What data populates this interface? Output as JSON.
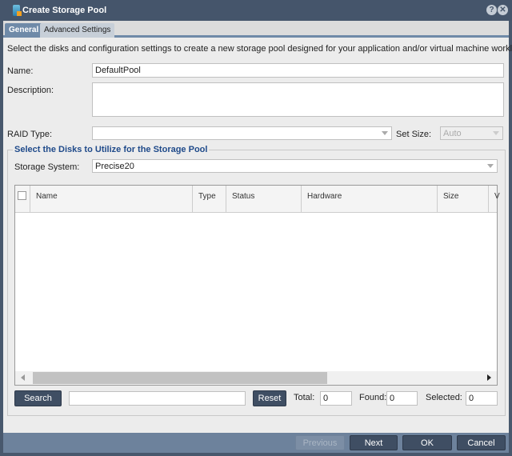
{
  "window": {
    "title": "Create Storage Pool",
    "icons": [
      "help-icon",
      "close-icon"
    ]
  },
  "tabs": [
    {
      "label": "General",
      "active": true
    },
    {
      "label": "Advanced Settings",
      "active": false
    }
  ],
  "intro": "Select the disks and configuration settings to create a new storage pool designed for your application and/or virtual machine workloads.",
  "form": {
    "name_label": "Name:",
    "name_value": "DefaultPool",
    "description_label": "Description:",
    "description_value": "",
    "raid_label": "RAID Type:",
    "raid_value": "",
    "setsize_label": "Set Size:",
    "setsize_value": "Auto"
  },
  "disks": {
    "legend": "Select the Disks to Utilize for the Storage Pool",
    "storage_label": "Storage System:",
    "storage_value": "Precise20",
    "columns": [
      "Name",
      "Type",
      "Status",
      "Hardware",
      "Size",
      "V"
    ],
    "rows": []
  },
  "search": {
    "search_label": "Search",
    "query": "",
    "reset_label": "Reset",
    "total_label": "Total:",
    "total": "0",
    "found_label": "Found:",
    "found": "0",
    "selected_label": "Selected:",
    "selected": "0"
  },
  "footer": {
    "previous": "Previous",
    "next": "Next",
    "ok": "OK",
    "cancel": "Cancel"
  }
}
